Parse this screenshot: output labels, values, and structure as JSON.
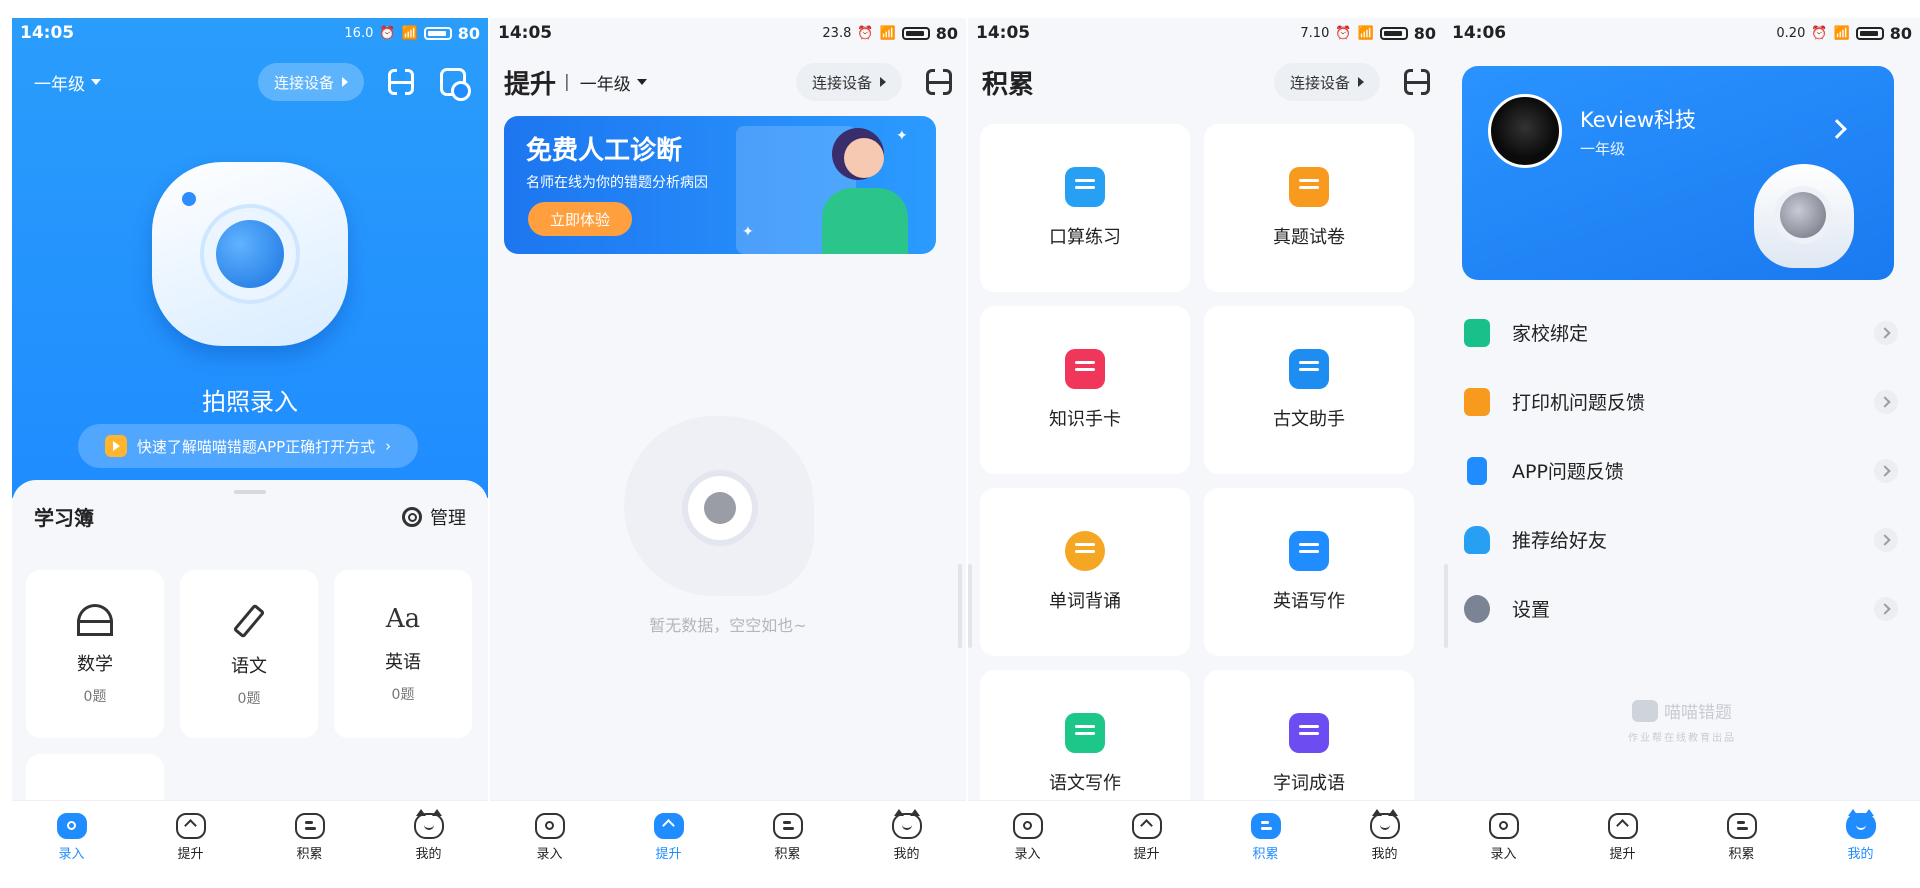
{
  "screens": {
    "record": {
      "status": {
        "time": "14:05",
        "speed": "16.0",
        "battery": "80"
      },
      "grade": "一年级",
      "connect": "连接设备",
      "hero_title": "拍照录入",
      "tip": "快速了解喵喵错题APP正确打开方式",
      "notebook_title": "学习簿",
      "manage": "管理",
      "subjects": [
        {
          "name": "数学",
          "count": "0题",
          "icon": "abacus-icon"
        },
        {
          "name": "语文",
          "count": "0题",
          "icon": "pen-icon"
        },
        {
          "name": "英语",
          "count": "0题",
          "icon": "aa-icon"
        }
      ]
    },
    "improve": {
      "status": {
        "time": "14:05",
        "speed": "23.8",
        "battery": "80"
      },
      "title": "提升",
      "grade": "一年级",
      "connect": "连接设备",
      "banner": {
        "title": "免费人工诊断",
        "sub": "名师在线为你的错题分析病因",
        "button": "立即体验"
      },
      "empty": "暂无数据，空空如也~"
    },
    "accumulate": {
      "status": {
        "time": "14:05",
        "speed": "7.10",
        "battery": "80"
      },
      "title": "积累",
      "connect": "连接设备",
      "tools": [
        {
          "label": "口算练习",
          "icon": "calculator-icon",
          "color": "#27a0f4"
        },
        {
          "label": "真题试卷",
          "icon": "exam-paper-icon",
          "color": "#f79a1e"
        },
        {
          "label": "知识手卡",
          "icon": "knowledge-card-icon",
          "color": "#f0375b"
        },
        {
          "label": "古文助手",
          "icon": "classics-icon",
          "color": "#1d8df2"
        },
        {
          "label": "单词背诵",
          "icon": "english-en-icon",
          "color": "#f5a623"
        },
        {
          "label": "英语写作",
          "icon": "english-a-icon",
          "color": "#1f8cff"
        },
        {
          "label": "语文写作",
          "icon": "chinese-writing-icon",
          "color": "#1dc78a"
        },
        {
          "label": "字词成语",
          "icon": "idiom-icon",
          "color": "#6d4df2"
        }
      ]
    },
    "mine": {
      "status": {
        "time": "14:06",
        "speed": "0.20",
        "battery": "80"
      },
      "profile": {
        "name": "Keview科技",
        "grade": "一年级"
      },
      "menu": [
        {
          "label": "家校绑定",
          "icon": "flag-icon",
          "color": "#19c08a"
        },
        {
          "label": "打印机问题反馈",
          "icon": "printer-icon",
          "color": "#f79a1e"
        },
        {
          "label": "APP问题反馈",
          "icon": "phone-icon",
          "color": "#1f8cff"
        },
        {
          "label": "推荐给好友",
          "icon": "gift-icon",
          "color": "#27a0f4"
        },
        {
          "label": "设置",
          "icon": "settings-icon",
          "color": "#7b8494"
        }
      ],
      "watermark": {
        "brand": "喵喵错题",
        "sub": "作业帮在线教育出品"
      }
    }
  },
  "nav": {
    "record": "录入",
    "improve": "提升",
    "accumulate": "积累",
    "mine": "我的"
  },
  "colors": {
    "primary": "#1f8cff",
    "orange": "#ff9f3d"
  }
}
